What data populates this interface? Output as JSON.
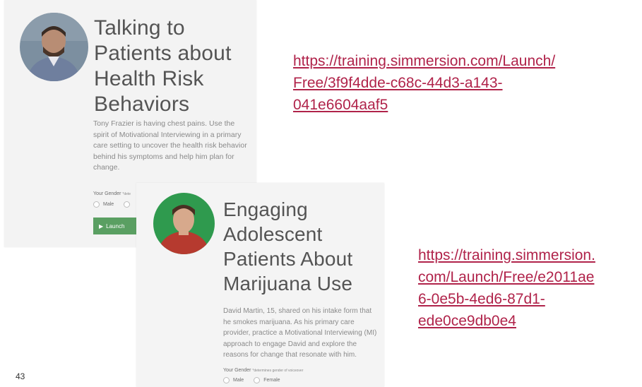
{
  "card1": {
    "title_lines": [
      "Talking to",
      "Patients about",
      "Health Risk",
      "Behaviors"
    ],
    "description": "Tony Frazier is having chest pains. Use the spirit of Motivational Interviewing in a primary care setting to uncover the health risk behavior behind his symptoms and help him plan for change.",
    "gender_label": "Your Gender",
    "gender_note": "*dete",
    "option_male": "Male",
    "launch_label": "Launch",
    "launch_color": "#5a9f62"
  },
  "card2": {
    "title_lines": [
      "Engaging",
      "Adolescent",
      "Patients About",
      "Marijuana Use"
    ],
    "description": "David Martin, 15, shared on his intake form that he smokes marijuana. As his primary care provider, practice a Motivational Interviewing (MI) approach to engage David and explore the reasons for change that resonate with him.",
    "gender_label": "Your Gender",
    "gender_note": "*determines gender of voiceover",
    "option_male": "Male",
    "option_female": "Female"
  },
  "links": {
    "link1_lines": [
      "https://training.simmersion.com/Launch/",
      "Free/3f9f4dde-c68c-44d3-a143-",
      "041e6604aaf5"
    ],
    "link2_lines": [
      "https://training.simmersion.",
      "com/Launch/Free/e2011ae",
      "6-0e5b-4ed6-87d1-",
      "ede0ce9db0e4"
    ],
    "color": "#b0234a"
  },
  "page_number": "43"
}
